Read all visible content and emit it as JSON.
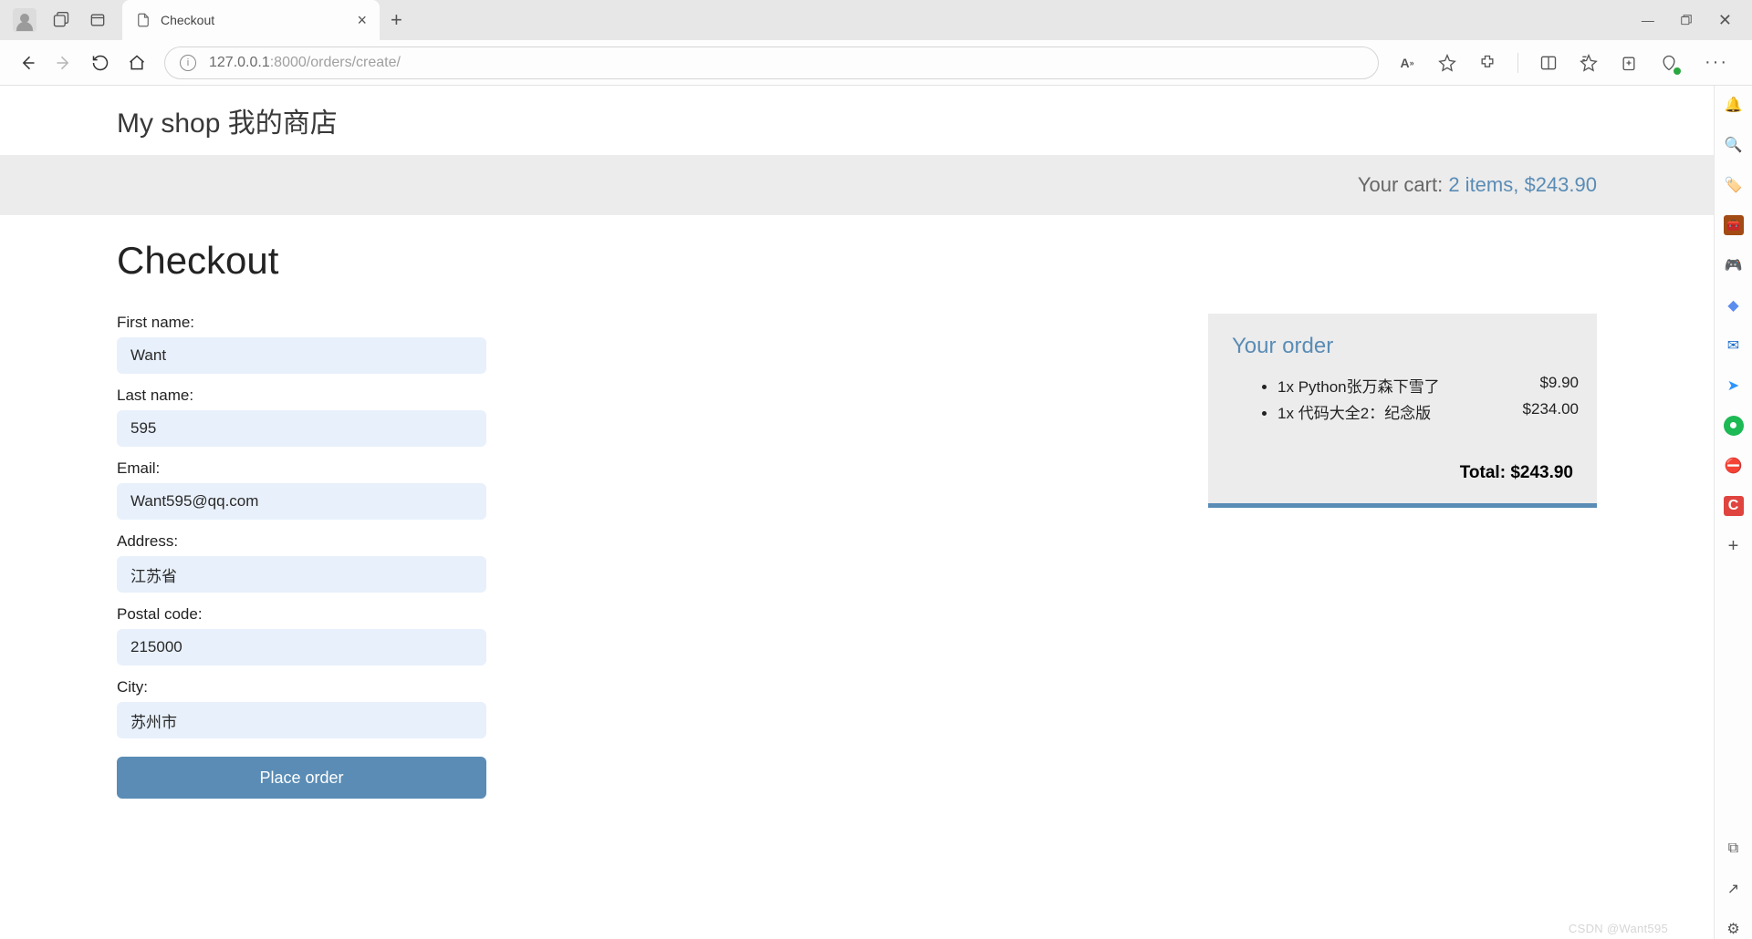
{
  "browser": {
    "tab_title": "Checkout",
    "url_host": "127.0.0.1",
    "url_port": ":8000",
    "url_path": "/orders/create/"
  },
  "shop": {
    "header": "My shop 我的商店",
    "cart_label": "Your cart:",
    "cart_summary": "2 items, $243.90"
  },
  "page": {
    "title": "Checkout",
    "submit_label": "Place order"
  },
  "form": {
    "first_name": {
      "label": "First name:",
      "value": "Want"
    },
    "last_name": {
      "label": "Last name:",
      "value": "595"
    },
    "email": {
      "label": "Email:",
      "value": "Want595@qq.com"
    },
    "address": {
      "label": "Address:",
      "value": "江苏省"
    },
    "postal": {
      "label": "Postal code:",
      "value": "215000"
    },
    "city": {
      "label": "City:",
      "value": "苏州市"
    }
  },
  "order": {
    "heading": "Your order",
    "items": [
      {
        "qty": "1x",
        "name": "Python张万森下雪了",
        "price": "$9.90"
      },
      {
        "qty": "1x",
        "name": "代码大全2：纪念版",
        "price": "$234.00"
      }
    ],
    "total_label": "Total:",
    "total_value": "$243.90"
  },
  "watermark": "CSDN @Want595"
}
